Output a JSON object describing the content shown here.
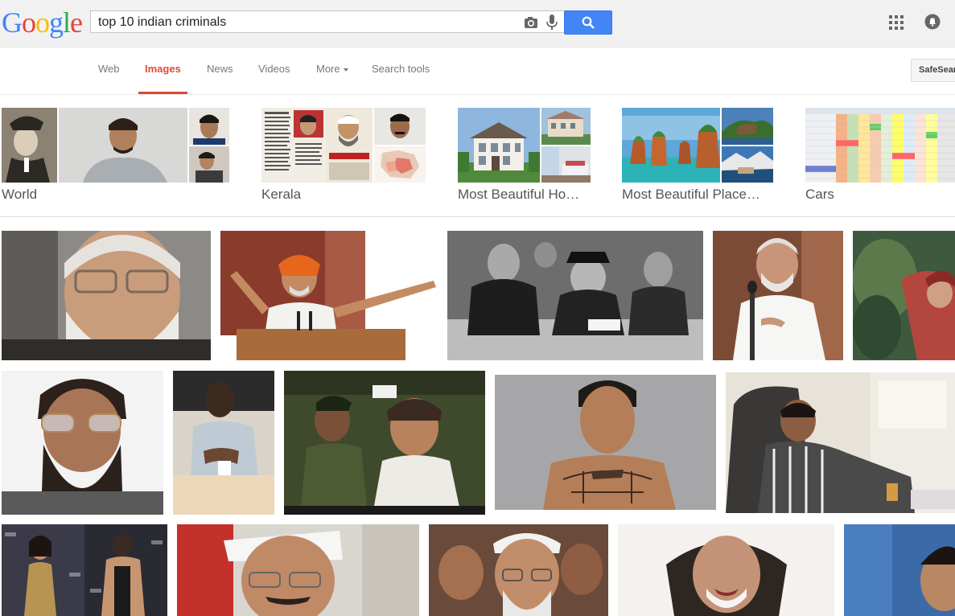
{
  "header": {
    "logo_letters": [
      "G",
      "o",
      "o",
      "g",
      "l",
      "e"
    ],
    "logo_colors": [
      "#4285f4",
      "#ea4335",
      "#fbbc05",
      "#4285f4",
      "#34a853",
      "#ea4335"
    ],
    "query": "top 10 indian criminals",
    "icons": [
      "camera-icon",
      "mic-icon",
      "search-icon",
      "apps-grid-icon",
      "notifications-icon"
    ]
  },
  "tabs": {
    "web": "Web",
    "images": "Images",
    "news": "News",
    "videos": "Videos",
    "more": "More",
    "search_tools": "Search tools",
    "safesearch": "SafeSearch"
  },
  "related": [
    {
      "label": "World"
    },
    {
      "label": "Kerala"
    },
    {
      "label": "Most Beautiful Ho…"
    },
    {
      "label": "Most Beautiful Place…"
    },
    {
      "label": "Cars"
    }
  ],
  "colors": {
    "accent": "#dd4b39",
    "search_button": "#4285f4",
    "topbar": "#f1f1f1"
  }
}
